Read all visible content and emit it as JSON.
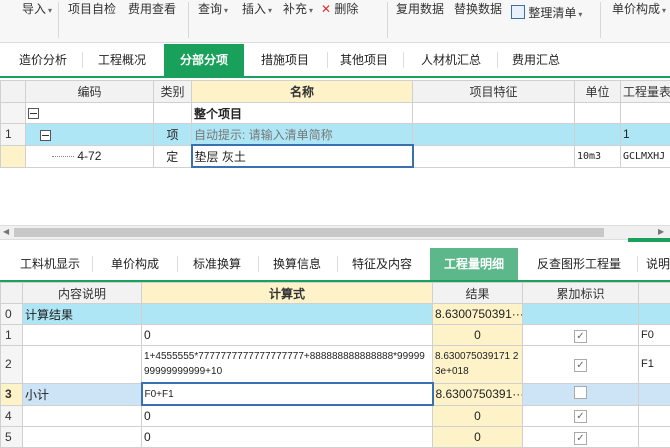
{
  "toolbar": {
    "items": [
      {
        "label": "导入",
        "caret": true
      },
      {
        "label": "项目自检",
        "caret": false
      },
      {
        "label": "费用查看",
        "caret": false
      },
      {
        "label": "查询",
        "caret": true
      },
      {
        "label": "插入",
        "caret": true
      },
      {
        "label": "补充",
        "caret": true
      },
      {
        "label": "删除",
        "caret": false
      },
      {
        "label": "复用数据",
        "caret": false
      },
      {
        "label": "替换数据",
        "caret": false
      },
      {
        "label": "整理清单",
        "caret": true
      },
      {
        "label": "单价构成",
        "caret": true
      }
    ]
  },
  "main_tabs": [
    "造价分析",
    "工程概况",
    "分部分项",
    "措施项目",
    "其他项目",
    "人材机汇总",
    "费用汇总"
  ],
  "main_tabs_active": "分部分项",
  "items_grid": {
    "headers": [
      "编码",
      "类别",
      "名称",
      "项目特征",
      "单位",
      "工程量表"
    ],
    "rows": [
      {
        "num": "",
        "code": "",
        "type": "",
        "name": "整个项目",
        "feature": "",
        "unit": "",
        "expr": ""
      },
      {
        "num": "1",
        "code": "",
        "type": "项",
        "name": "自动提示: 请输入清单简称",
        "feature": "",
        "unit": "",
        "expr": "1"
      },
      {
        "num": "",
        "code": "4-72",
        "type": "定",
        "name": "垫层 灰土",
        "feature": "",
        "unit": "10m3",
        "expr": "GCLMXHJ"
      }
    ]
  },
  "sub_tabs": [
    "工料机显示",
    "单价构成",
    "标准换算",
    "换算信息",
    "特征及内容",
    "工程量明细",
    "反查图形工程量",
    "说明"
  ],
  "sub_tabs_active": "工程量明细",
  "detail_grid": {
    "headers": [
      "内容说明",
      "计算式",
      "结果",
      "累加标识"
    ],
    "rows": [
      {
        "num": "0",
        "desc": "计算结果",
        "expr": "",
        "result": "8.6300750391···",
        "checked": null,
        "ref": ""
      },
      {
        "num": "1",
        "desc": "",
        "expr": "0",
        "result": "0",
        "checked": true,
        "ref": "F0"
      },
      {
        "num": "2",
        "desc": "",
        "expr": "1+4555555*7777777777777777777+888888888888888*9999999999999999+10",
        "result": "8.630075039171 23e+018",
        "checked": true,
        "ref": "F1"
      },
      {
        "num": "3",
        "desc": "小计",
        "expr": "F0+F1",
        "result": "8.6300750391···",
        "checked": false,
        "ref": ""
      },
      {
        "num": "4",
        "desc": "",
        "expr": "0",
        "result": "0",
        "checked": true,
        "ref": ""
      },
      {
        "num": "5",
        "desc": "",
        "expr": "0",
        "result": "0",
        "checked": true,
        "ref": ""
      }
    ]
  },
  "colors": {
    "accent": "#19a05a",
    "cyan_row": "#aee6f5",
    "selected_row": "#cde4f7",
    "header_highlight": "#fdf2c8"
  }
}
